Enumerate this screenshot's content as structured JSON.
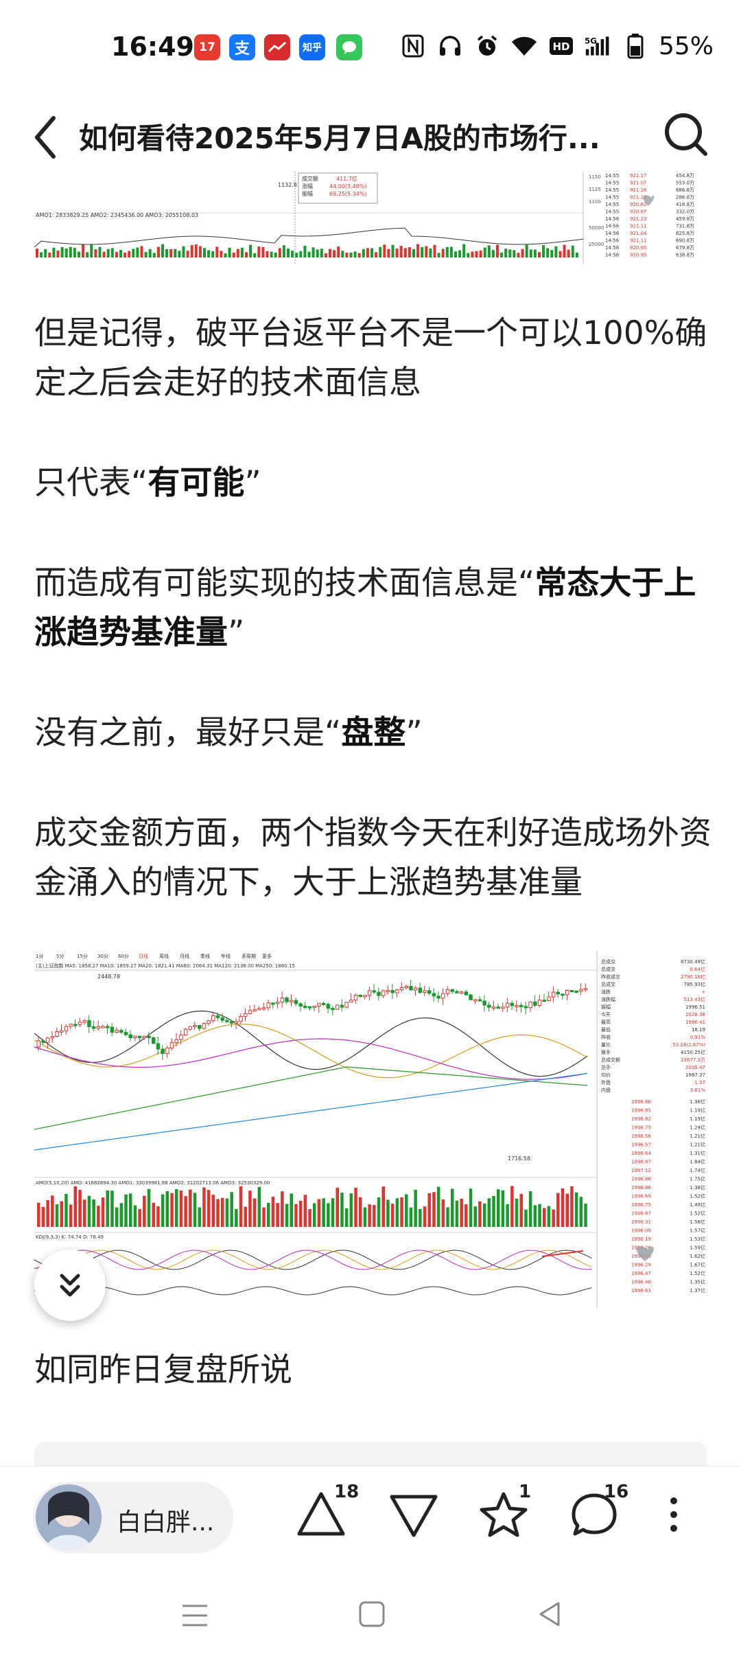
{
  "status_bar": {
    "time": "16:49",
    "apps": [
      {
        "icon": "app-icon-red-news",
        "color": "#e93a2f",
        "text": "17"
      },
      {
        "icon": "alipay-icon",
        "color": "#1677ff",
        "text": "支"
      },
      {
        "icon": "app-icon-red-stock",
        "color": "#d92b2b",
        "text": ""
      },
      {
        "icon": "zhihu-icon",
        "color": "#0f6ef5",
        "text": "知乎"
      },
      {
        "icon": "wechat-msg-icon",
        "color": "#35c759",
        "text": ""
      }
    ],
    "battery_percent": "55%"
  },
  "header": {
    "title": "如何看待2025年5月7日A股的市场行..."
  },
  "article": {
    "p1": "但是记得，破平台返平台不是一个可以100%确定之后会走好的技术面信息",
    "p2_pre": "只代表“",
    "p2_bold": "有可能",
    "p2_post": "”",
    "p3_pre": "而造成有可能实现的技术面信息是“",
    "p3_bold": "常态大于上涨趋势基准量",
    "p3_post": "”",
    "p4_pre": "没有之前，最好只是“",
    "p4_bold": "盘整",
    "p4_post": "”",
    "p5": "成交金额方面，两个指数今天在利好造成场外资金涌入的情况下，大于上涨趋势基准量",
    "p6": "如同昨日复盘所说"
  },
  "chart_top": {
    "tooltip_lines": [
      "成交额",
      "涨幅",
      "振幅"
    ],
    "tooltip_values": [
      "411.7亿",
      "44.00(3.48%)",
      "69.25(5.34%)"
    ],
    "low_label": "1132.8",
    "indicator_line": "AMO1: 2833829.25 AMO2: 2345436.00 AMO3: 2055108.03",
    "axis_labels": [
      "1150",
      "1125",
      "1100",
      "50000",
      "25000"
    ],
    "tick_times": [
      "14:55",
      "14:55",
      "14:55",
      "14:55",
      "14:55",
      "14:55",
      "14:56",
      "14:56",
      "14:56",
      "14:56",
      "14:56",
      "14:56"
    ],
    "tick_prices": [
      "921.17",
      "921.07",
      "921.16",
      "921.19",
      "920.82",
      "920.87",
      "921.23",
      "921.11",
      "921.04",
      "921.11",
      "920.95",
      "920.95"
    ],
    "tick_vols": [
      "454.8万",
      "553.0万",
      "686.8万",
      "286.8万",
      "418.8万",
      "332.0万",
      "459.8万",
      "731.8万",
      "625.8万",
      "690.8万",
      "679.8万",
      "638.8万"
    ]
  },
  "chart_bottom": {
    "tabs": [
      "1分",
      "5分",
      "15分",
      "30分",
      "60分",
      "日线",
      "周线",
      "月线",
      "季线",
      "年线",
      "多周期",
      "更多"
    ],
    "indicator_top": "(主)上证指数 MA5: 1858.27 MA10: 1859.27 MA20: 1821.41 MA60: 2064.31 MA120: 2138.00 MA250: 1860.15",
    "high_label": "2448.78",
    "low_label": "1716.58",
    "vol_line": "AMO(5,10,20) AMO: 41682894.30 AMO1: 33039981.88 AMO2: 31202713.06 AMO3: 32530329.00",
    "kdj_line": "KDJ(9,3,3) K: 74.74 D: 78.49",
    "right_labels": [
      "总成交",
      "总成交",
      "昨收成交",
      "总成交",
      "涨跌",
      "涨跌幅",
      "振幅",
      "今开",
      "最高",
      "最低",
      "昨收",
      "量比",
      "换手",
      "总成交额",
      "总手",
      "均价",
      "外盘",
      "内盘"
    ],
    "right_values": [
      "8730.49亿",
      "0.64亿",
      "2790.18亿",
      "785.93亿",
      "+",
      "513.43亿",
      "1996.51",
      "2028.38",
      "1986.41",
      "18.19",
      "0.91%",
      "53.18(2.67%)",
      "4150.25亿",
      "23677.3万",
      "2035.47",
      "1987.37",
      "1.37",
      "3.81%"
    ],
    "tick_prices": [
      "1996.86",
      "1996.85",
      "1996.82",
      "1996.75",
      "1996.56",
      "1996.57",
      "1996.64",
      "1996.87",
      "1997.12",
      "1996.86",
      "1996.88",
      "1996.69",
      "1996.75",
      "1996.87",
      "1996.31",
      "1996.09",
      "1996.19",
      "1996.26",
      "1996.30",
      "1996.29",
      "1996.47",
      "1996.46",
      "1996.63"
    ],
    "tick_vols": [
      "1.38亿",
      "1.19亿",
      "1.19亿",
      "1.24亿",
      "1.21亿",
      "1.21亿",
      "1.31亿",
      "1.84亿",
      "1.74亿",
      "1.75亿",
      "1.38亿",
      "1.52亿",
      "1.49亿",
      "1.52亿",
      "1.58亿",
      "1.57亿",
      "1.53亿",
      "1.59亿",
      "1.62亿",
      "1.67亿",
      "1.52亿",
      "1.35亿",
      "1.37亿"
    ]
  },
  "bottom_bar": {
    "author_name": "白白胖...",
    "upvote_count": "18",
    "star_count": "1",
    "comment_count": "16"
  },
  "colors": {
    "up_red": "#e0322f",
    "down_green": "#1a9a2c",
    "text": "#222222"
  }
}
